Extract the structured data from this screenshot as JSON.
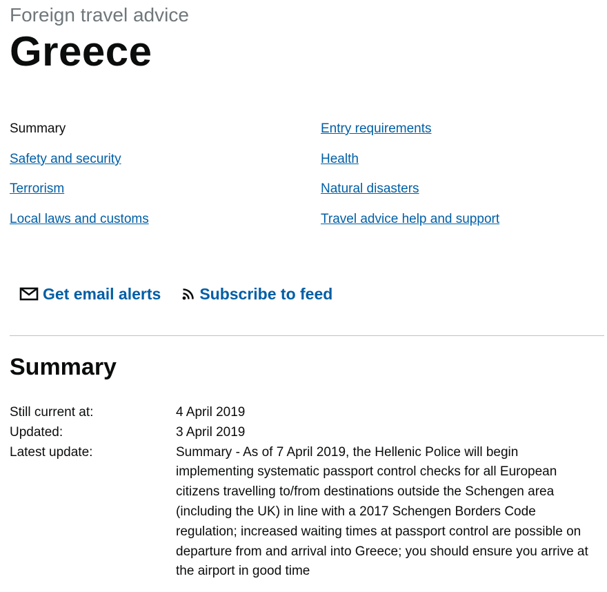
{
  "header": {
    "caption": "Foreign travel advice",
    "title": "Greece"
  },
  "contents": {
    "left": [
      {
        "label": "Summary",
        "current": true
      },
      {
        "label": "Safety and security",
        "current": false
      },
      {
        "label": "Terrorism",
        "current": false
      },
      {
        "label": "Local laws and customs",
        "current": false
      }
    ],
    "right": [
      {
        "label": "Entry requirements",
        "current": false
      },
      {
        "label": "Health",
        "current": false
      },
      {
        "label": "Natural disasters",
        "current": false
      },
      {
        "label": "Travel advice help and support",
        "current": false
      }
    ]
  },
  "actions": {
    "email_alerts": "Get email alerts",
    "subscribe_feed": "Subscribe to feed",
    "email_icon": "envelope-icon",
    "feed_icon": "rss-feed-icon"
  },
  "summary": {
    "heading": "Summary",
    "still_current_label": "Still current at:",
    "still_current_value": "4 April 2019",
    "updated_label": "Updated:",
    "updated_value": "3 April 2019",
    "latest_update_label": "Latest update:",
    "latest_update_value": "Summary - As of 7 April 2019, the Hellenic Police will begin implementing systematic passport control checks for all European citizens travelling to/from destinations outside the Schengen area (including the UK) in line with a 2017 Schengen Borders Code regulation; increased waiting times at passport control are possible on departure from and arrival into Greece; you should ensure you arrive at the airport in good time"
  },
  "colors": {
    "link": "#005ea5",
    "text": "#0b0c0c",
    "secondary_text": "#6f777b",
    "divider": "#bfc1c3"
  }
}
